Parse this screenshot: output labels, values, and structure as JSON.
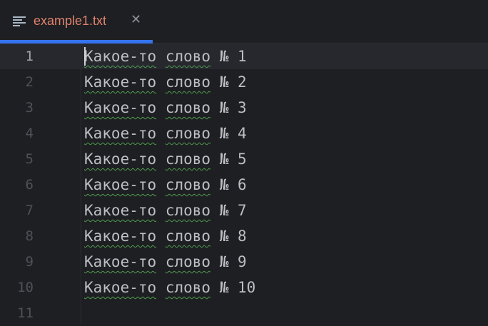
{
  "tab": {
    "label": "example1.txt",
    "close_icon": "close-icon",
    "file_icon": "text-file-icon"
  },
  "editor": {
    "lines": [
      {
        "number": "1",
        "text": "Какое-то слово № 1"
      },
      {
        "number": "2",
        "text": "Какое-то слово № 2"
      },
      {
        "number": "3",
        "text": "Какое-то слово № 3"
      },
      {
        "number": "4",
        "text": "Какое-то слово № 4"
      },
      {
        "number": "5",
        "text": "Какое-то слово № 5"
      },
      {
        "number": "6",
        "text": "Какое-то слово № 6"
      },
      {
        "number": "7",
        "text": "Какое-то слово № 7"
      },
      {
        "number": "8",
        "text": "Какое-то слово № 8"
      },
      {
        "number": "9",
        "text": "Какое-то слово № 9"
      },
      {
        "number": "10",
        "text": "Какое-то слово № 10"
      },
      {
        "number": "11",
        "text": ""
      }
    ],
    "current_line": "1"
  },
  "colors": {
    "accent": "#3574f0",
    "tab_label": "#e0826d",
    "spell_underline": "#4f9b4f"
  }
}
